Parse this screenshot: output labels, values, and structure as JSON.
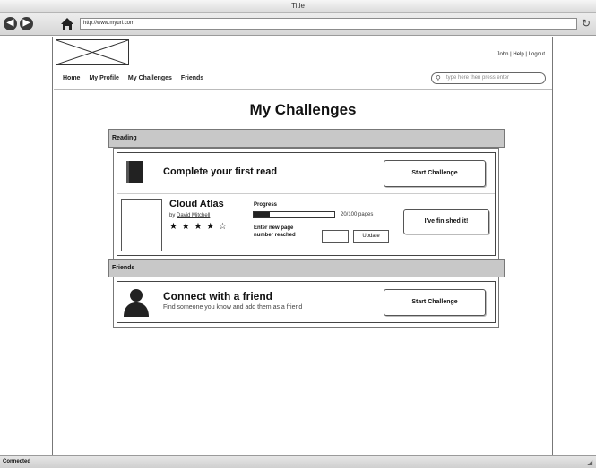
{
  "browser": {
    "title": "Title",
    "url": "http://www.myurl.com",
    "status": "Connected",
    "back_glyph": "◀",
    "forward_glyph": "▶",
    "reload_glyph": "↻"
  },
  "header": {
    "user_links": [
      "John",
      "Help",
      "Logout"
    ],
    "separator": " | "
  },
  "nav": {
    "items": [
      "Home",
      "My Profile",
      "My Challenges",
      "Friends"
    ],
    "search_placeholder": "type here then press enter"
  },
  "page": {
    "title": "My Challenges"
  },
  "reading": {
    "section_label": "Reading",
    "challenge_title": "Complete your first read",
    "start_button": "Start Challenge",
    "book": {
      "title": "Cloud Atlas",
      "by_prefix": "by",
      "author": "David Mitchell",
      "rating": 4,
      "rating_max": 5,
      "stars_text": "★ ★ ★ ★ ☆"
    },
    "progress": {
      "label": "Progress",
      "current": 20,
      "total": 100,
      "pages_text": "20/100 pages",
      "enter_label_line1": "Enter new page",
      "enter_label_line2": "number reached",
      "input_value": "",
      "update_button": "Update"
    },
    "finished_button": "I've finished it!"
  },
  "friends": {
    "section_label": "Friends",
    "challenge_title": "Connect with a friend",
    "challenge_subtitle": "Find someone you know and add them as a friend",
    "start_button": "Start Challenge"
  }
}
